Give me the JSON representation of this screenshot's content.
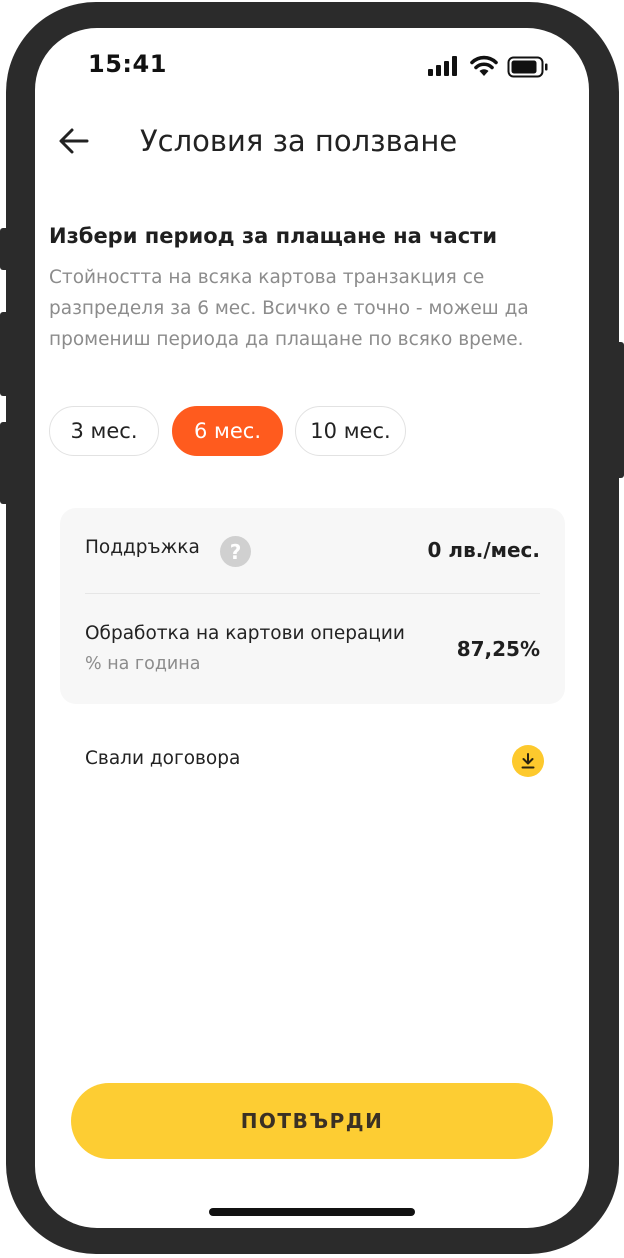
{
  "status_bar": {
    "time": "15:41"
  },
  "header": {
    "title": "Условия за ползване"
  },
  "section": {
    "title": "Избери период за плащане на части",
    "description": "Стойността на всяка картова транзакция се разпределя за 6 мес. Всичко е точно - можеш да промениш периода да плащане по всяко време."
  },
  "periods": {
    "selected": "6 мес.",
    "options": [
      {
        "label": "3 мес."
      },
      {
        "label": "6 мес."
      },
      {
        "label": "10 мес."
      }
    ]
  },
  "fees": {
    "maintenance": {
      "label": "Поддръжка",
      "value": "0 лв./мес."
    },
    "processing": {
      "label": "Обработка на картови операции",
      "sublabel": "% на година",
      "value": "87,25%"
    }
  },
  "download": {
    "label": "Свали договора"
  },
  "confirm": {
    "label": "ПОТВЪРДИ"
  },
  "colors": {
    "accent_orange": "#ff5b1e",
    "accent_yellow": "#fdcd33",
    "card_bg": "#f7f7f7"
  },
  "icons": [
    "back-arrow-icon",
    "signal-icon",
    "wifi-icon",
    "battery-icon",
    "help-icon",
    "download-icon"
  ]
}
